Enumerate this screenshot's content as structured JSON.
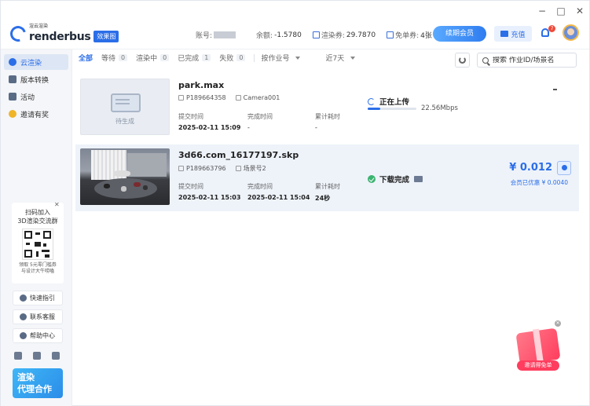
{
  "app": {
    "logo_small": "渲云渲染",
    "logo_name": "renderbus",
    "edition_badge": "效果图",
    "window_controls": [
      "−",
      "□",
      "✕"
    ]
  },
  "account": {
    "account_label": "账号:",
    "balance_label": "余额:",
    "balance_value": "-1.5780",
    "coupon_label": "渲染券:",
    "coupon_value": "29.7870",
    "free_label": "免单券:",
    "free_value": "4张",
    "renew_vip": "续期会员",
    "recharge": "充值",
    "notification_count": "7"
  },
  "sidebar": {
    "items": [
      {
        "label": "云渲染",
        "icon": "cloud-render-icon"
      },
      {
        "label": "版本转换",
        "icon": "version-convert-icon"
      },
      {
        "label": "活动",
        "icon": "activity-icon"
      },
      {
        "label": "邀请有奖",
        "icon": "invite-reward-icon"
      }
    ],
    "qr_card": {
      "title_1": "扫码加入",
      "title_2": "3D渲染交流群",
      "desc_1": "领取 5元零门槛券",
      "desc_2": "与设计大牛唠嗑"
    },
    "buttons": [
      "快速指引",
      "联系客服",
      "帮助中心"
    ],
    "promo_1": "渲染",
    "promo_2": "代理合作"
  },
  "filters": {
    "tabs": [
      {
        "label": "全部",
        "count": ""
      },
      {
        "label": "等待",
        "count": "0"
      },
      {
        "label": "渲染中",
        "count": "0"
      },
      {
        "label": "已完成",
        "count": "1"
      },
      {
        "label": "失败",
        "count": "0"
      }
    ],
    "sort": "按作业号",
    "range": "近7天",
    "search_placeholder": "搜索 作业ID/场景名"
  },
  "jobs": [
    {
      "thumb_label": "待生成",
      "name": "park.max",
      "job_id": "P189664358",
      "scene": "Camera001",
      "submit_label": "提交时间",
      "submit_time": "2025-02-11 15:09",
      "complete_label": "完成时间",
      "complete_time": "-",
      "elapsed_label": "累计耗时",
      "elapsed": "-",
      "status": "正在上传",
      "upload_progress": 0.25,
      "speed": "22.56Mbps"
    },
    {
      "name": "3d66.com_16177197.skp",
      "job_id": "P189663796",
      "scene": "场景号2",
      "submit_label": "提交时间",
      "submit_time": "2025-02-11 15:03",
      "complete_label": "完成时间",
      "complete_time": "2025-02-11 15:04",
      "elapsed_label": "累计耗时",
      "elapsed": "24秒",
      "status": "下载完成",
      "price": "¥ 0.012",
      "member_discount": "会员已优惠 ¥ 0.0040"
    }
  ],
  "gift": {
    "label": "邀请得免单"
  },
  "colors": {
    "accent": "#2b6ee8",
    "success": "#3cb371",
    "danger": "#f04a3a"
  }
}
